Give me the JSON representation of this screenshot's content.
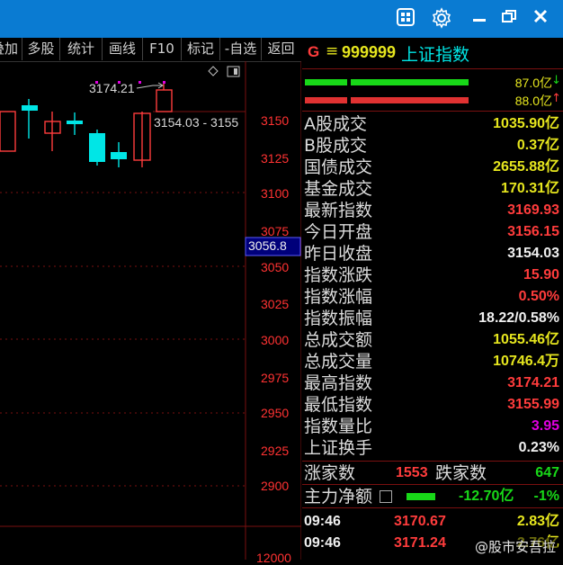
{
  "toolbar": {
    "items": [
      "叠加",
      "多股",
      "统计",
      "画线",
      "F10",
      "标记",
      "-自选",
      "返回"
    ]
  },
  "chart": {
    "high_label": "3174.21",
    "range_label": "3154.03 - 3155",
    "current_price_marker": "3056.8",
    "y_ticks": [
      "3150",
      "3125",
      "3100",
      "3075",
      "3050",
      "3025",
      "3000",
      "2975",
      "2950",
      "2925",
      "2900"
    ],
    "volume_tick": "12000"
  },
  "header": {
    "flag": "G",
    "menu_symbol": "≡",
    "code": "999999",
    "name": "上证指数"
  },
  "bars": {
    "buy_amount": "87.0亿",
    "sell_amount": "88.0亿"
  },
  "stats": [
    {
      "label": "A股成交",
      "value": "1035.90亿",
      "color": "yellow"
    },
    {
      "label": "B股成交",
      "value": "0.37亿",
      "color": "yellow"
    },
    {
      "label": "国债成交",
      "value": "2655.88亿",
      "color": "yellow"
    },
    {
      "label": "基金成交",
      "value": "170.31亿",
      "color": "yellow"
    },
    {
      "label": "最新指数",
      "value": "3169.93",
      "color": "red"
    },
    {
      "label": "今日开盘",
      "value": "3156.15",
      "color": "red"
    },
    {
      "label": "昨日收盘",
      "value": "3154.03",
      "color": "white"
    },
    {
      "label": "指数涨跌",
      "value": "15.90",
      "color": "red"
    },
    {
      "label": "指数涨幅",
      "value": "0.50%",
      "color": "red"
    },
    {
      "label": "指数振幅",
      "value": "18.22/0.58%",
      "color": "white"
    },
    {
      "label": "总成交额",
      "value": "1055.46亿",
      "color": "yellow"
    },
    {
      "label": "总成交量",
      "value": "10746.4万",
      "color": "yellow"
    },
    {
      "label": "最高指数",
      "value": "3174.21",
      "color": "red"
    },
    {
      "label": "最低指数",
      "value": "3155.99",
      "color": "red"
    },
    {
      "label": "指数量比",
      "value": "3.95",
      "color": "magenta"
    },
    {
      "label": "上证换手",
      "value": "0.23%",
      "color": "white"
    }
  ],
  "breadth": {
    "up_label": "涨家数",
    "up_count": "1553",
    "down_label": "跌家数",
    "down_count": "647"
  },
  "main_force": {
    "label": "主力净额",
    "value": "-12.70亿",
    "pct": "-1%"
  },
  "ticks": [
    {
      "time": "09:46",
      "price": "3170.67",
      "vol": "2.83亿"
    },
    {
      "time": "09:46",
      "price": "3171.24",
      "vol": "2.76亿"
    }
  ],
  "watermark": "@股市安吾拉",
  "colors": {
    "titlebar": "#0a7bd2",
    "up": "#ff3c3c",
    "down": "#00e6e6",
    "accent_yellow": "#e6e61e"
  }
}
